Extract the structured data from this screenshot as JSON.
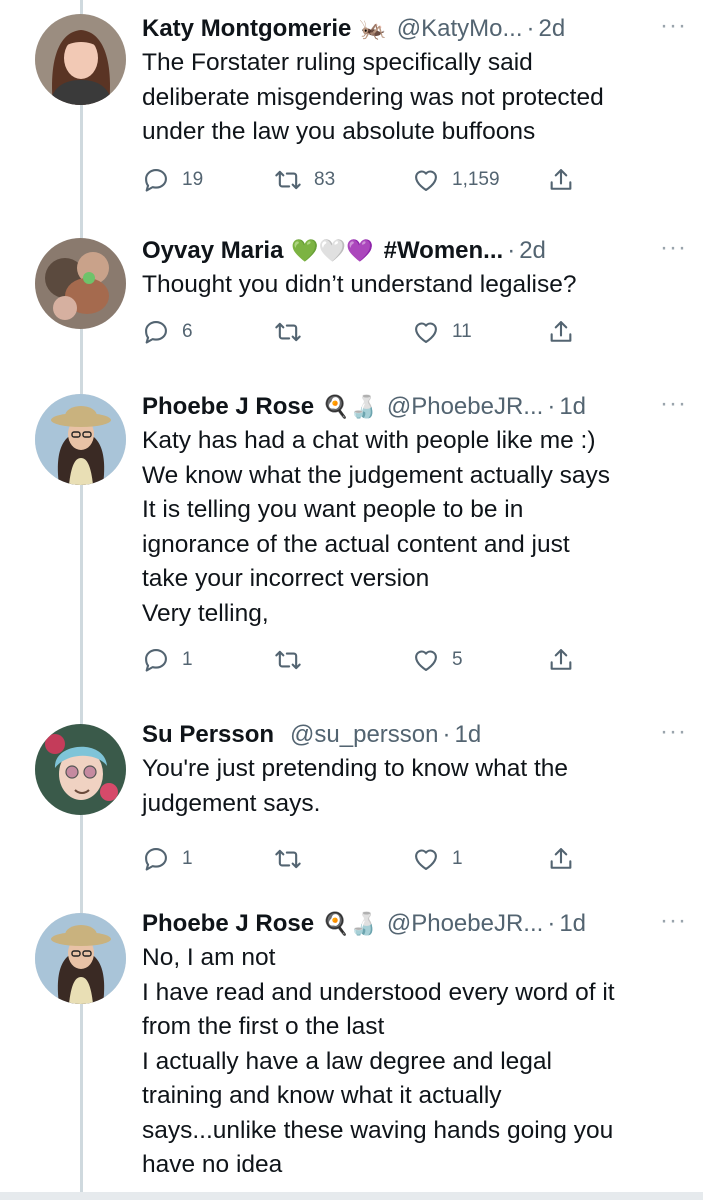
{
  "tweets": [
    {
      "name": "Katy Montgomerie",
      "badge": "🦗",
      "handle": "@KatyMo...",
      "time": "2d",
      "more": "···",
      "lines": [
        "The Forstater ruling specifically said",
        "deliberate misgendering was not protected",
        "under the law you absolute buffoons"
      ],
      "replies": "19",
      "retweets": "83",
      "likes": "1,159"
    },
    {
      "name": "Oyvay Maria",
      "badge": "💚🤍💜",
      "handle": "#Women...",
      "time": "2d",
      "more": "···",
      "lines": [
        "Thought you didn’t understand legalise?"
      ],
      "replies": "6",
      "retweets": "",
      "likes": "11"
    },
    {
      "name": "Phoebe J Rose",
      "badge": "🍳🍶",
      "handle": "@PhoebeJR...",
      "time": "1d",
      "more": "···",
      "lines": [
        "Katy has had a chat with people like me :)",
        "We know what the judgement actually says",
        "It is telling you want people to be in",
        "ignorance of the actual content and just",
        "take your incorrect version",
        "Very telling,"
      ],
      "replies": "1",
      "retweets": "",
      "likes": "5"
    },
    {
      "name": "Su Persson",
      "badge": "",
      "handle": "@su_persson",
      "time": "1d",
      "more": "···",
      "lines": [
        "You're just pretending to know what the",
        "judgement says."
      ],
      "replies": "1",
      "retweets": "",
      "likes": "1"
    },
    {
      "name": "Phoebe J Rose",
      "badge": "🍳🍶",
      "handle": "@PhoebeJR...",
      "time": "1d",
      "more": "···",
      "lines": [
        "No, I am not",
        "I have read and understood every word of it",
        "from the first o the last",
        "I actually have a law degree and legal",
        "training and know what it actually",
        "says...unlike these waving hands going you",
        "have no idea"
      ],
      "replies": "",
      "retweets": "",
      "likes": ""
    }
  ],
  "separator": "·",
  "colors": {
    "text": "#0f1419",
    "muted": "#536471",
    "thread_line": "#cfd9de"
  },
  "icons": {
    "reply": "reply-icon",
    "retweet": "retweet-icon",
    "like": "heart-icon",
    "share": "share-icon",
    "more": "more-icon"
  }
}
